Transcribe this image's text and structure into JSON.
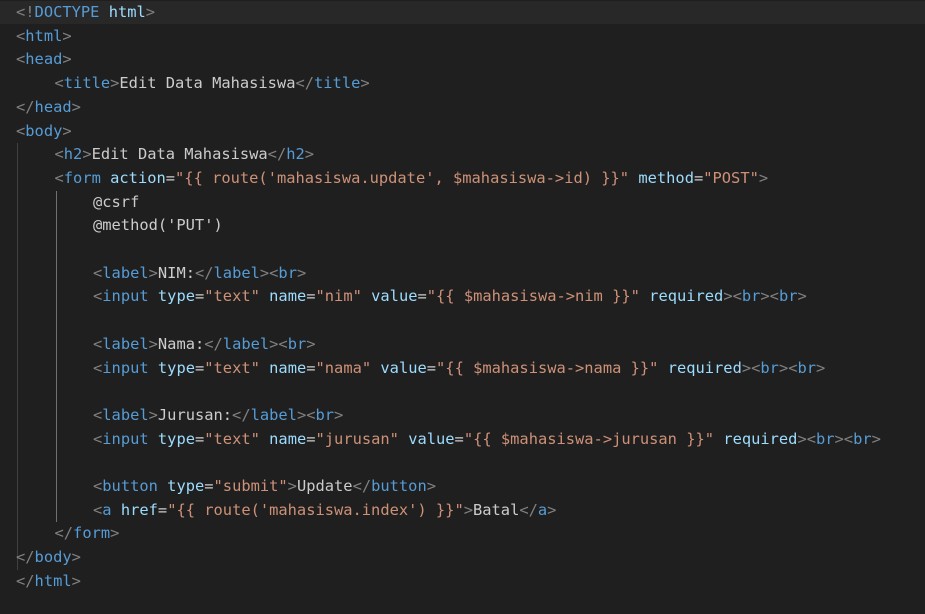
{
  "colors": {
    "background": "#1f1f1f",
    "current_line": "#282828",
    "tag": "#569cd6",
    "attribute": "#9cdcfe",
    "string": "#ce9178",
    "text": "#cccccc",
    "bracket": "#808080"
  },
  "editor": {
    "lines": [
      {
        "indent": 0,
        "tokens": [
          {
            "k": "punct",
            "t": "<!"
          },
          {
            "k": "tag",
            "t": "DOCTYPE"
          },
          {
            "k": "text",
            "t": " "
          },
          {
            "k": "attr",
            "t": "html"
          },
          {
            "k": "punct",
            "t": ">"
          }
        ]
      },
      {
        "indent": 0,
        "tokens": [
          {
            "k": "punct",
            "t": "<"
          },
          {
            "k": "tag",
            "t": "html"
          },
          {
            "k": "punct",
            "t": ">"
          }
        ]
      },
      {
        "indent": 0,
        "tokens": [
          {
            "k": "punct",
            "t": "<"
          },
          {
            "k": "tag",
            "t": "head"
          },
          {
            "k": "punct",
            "t": ">"
          }
        ]
      },
      {
        "indent": 1,
        "tokens": [
          {
            "k": "punct",
            "t": "<"
          },
          {
            "k": "tag",
            "t": "title"
          },
          {
            "k": "punct",
            "t": ">"
          },
          {
            "k": "text",
            "t": "Edit Data Mahasiswa"
          },
          {
            "k": "punct",
            "t": "</"
          },
          {
            "k": "tag",
            "t": "title"
          },
          {
            "k": "punct",
            "t": ">"
          }
        ]
      },
      {
        "indent": 0,
        "tokens": [
          {
            "k": "punct",
            "t": "</"
          },
          {
            "k": "tag",
            "t": "head"
          },
          {
            "k": "punct",
            "t": ">"
          }
        ]
      },
      {
        "indent": 0,
        "tokens": [
          {
            "k": "punct",
            "t": "<"
          },
          {
            "k": "tag",
            "t": "body"
          },
          {
            "k": "punct",
            "t": ">"
          }
        ]
      },
      {
        "indent": 1,
        "tokens": [
          {
            "k": "punct",
            "t": "<"
          },
          {
            "k": "tag",
            "t": "h2"
          },
          {
            "k": "punct",
            "t": ">"
          },
          {
            "k": "text",
            "t": "Edit Data Mahasiswa"
          },
          {
            "k": "punct",
            "t": "</"
          },
          {
            "k": "tag",
            "t": "h2"
          },
          {
            "k": "punct",
            "t": ">"
          }
        ]
      },
      {
        "indent": 1,
        "tokens": [
          {
            "k": "punct",
            "t": "<"
          },
          {
            "k": "tag",
            "t": "form"
          },
          {
            "k": "text",
            "t": " "
          },
          {
            "k": "attr",
            "t": "action"
          },
          {
            "k": "eq",
            "t": "="
          },
          {
            "k": "str",
            "t": "\"{{ route('mahasiswa.update', $mahasiswa->id) }}\""
          },
          {
            "k": "text",
            "t": " "
          },
          {
            "k": "attr",
            "t": "method"
          },
          {
            "k": "eq",
            "t": "="
          },
          {
            "k": "str",
            "t": "\"POST\""
          },
          {
            "k": "punct",
            "t": ">"
          }
        ]
      },
      {
        "indent": 2,
        "tokens": [
          {
            "k": "directive",
            "t": "@csrf"
          }
        ]
      },
      {
        "indent": 2,
        "tokens": [
          {
            "k": "directive",
            "t": "@method('PUT')"
          }
        ]
      },
      {
        "indent": 0,
        "tokens": []
      },
      {
        "indent": 2,
        "tokens": [
          {
            "k": "punct",
            "t": "<"
          },
          {
            "k": "tag",
            "t": "label"
          },
          {
            "k": "punct",
            "t": ">"
          },
          {
            "k": "text",
            "t": "NIM:"
          },
          {
            "k": "punct",
            "t": "</"
          },
          {
            "k": "tag",
            "t": "label"
          },
          {
            "k": "punct",
            "t": "><"
          },
          {
            "k": "tag",
            "t": "br"
          },
          {
            "k": "punct",
            "t": ">"
          }
        ]
      },
      {
        "indent": 2,
        "tokens": [
          {
            "k": "punct",
            "t": "<"
          },
          {
            "k": "tag",
            "t": "input"
          },
          {
            "k": "text",
            "t": " "
          },
          {
            "k": "attr",
            "t": "type"
          },
          {
            "k": "eq",
            "t": "="
          },
          {
            "k": "str",
            "t": "\"text\""
          },
          {
            "k": "text",
            "t": " "
          },
          {
            "k": "attr",
            "t": "name"
          },
          {
            "k": "eq",
            "t": "="
          },
          {
            "k": "str",
            "t": "\"nim\""
          },
          {
            "k": "text",
            "t": " "
          },
          {
            "k": "attr",
            "t": "value"
          },
          {
            "k": "eq",
            "t": "="
          },
          {
            "k": "str",
            "t": "\"{{ $mahasiswa->nim }}\""
          },
          {
            "k": "text",
            "t": " "
          },
          {
            "k": "attr",
            "t": "required"
          },
          {
            "k": "punct",
            "t": "><"
          },
          {
            "k": "tag",
            "t": "br"
          },
          {
            "k": "punct",
            "t": "><"
          },
          {
            "k": "tag",
            "t": "br"
          },
          {
            "k": "punct",
            "t": ">"
          }
        ]
      },
      {
        "indent": 0,
        "tokens": []
      },
      {
        "indent": 2,
        "tokens": [
          {
            "k": "punct",
            "t": "<"
          },
          {
            "k": "tag",
            "t": "label"
          },
          {
            "k": "punct",
            "t": ">"
          },
          {
            "k": "text",
            "t": "Nama:"
          },
          {
            "k": "punct",
            "t": "</"
          },
          {
            "k": "tag",
            "t": "label"
          },
          {
            "k": "punct",
            "t": "><"
          },
          {
            "k": "tag",
            "t": "br"
          },
          {
            "k": "punct",
            "t": ">"
          }
        ]
      },
      {
        "indent": 2,
        "tokens": [
          {
            "k": "punct",
            "t": "<"
          },
          {
            "k": "tag",
            "t": "input"
          },
          {
            "k": "text",
            "t": " "
          },
          {
            "k": "attr",
            "t": "type"
          },
          {
            "k": "eq",
            "t": "="
          },
          {
            "k": "str",
            "t": "\"text\""
          },
          {
            "k": "text",
            "t": " "
          },
          {
            "k": "attr",
            "t": "name"
          },
          {
            "k": "eq",
            "t": "="
          },
          {
            "k": "str",
            "t": "\"nama\""
          },
          {
            "k": "text",
            "t": " "
          },
          {
            "k": "attr",
            "t": "value"
          },
          {
            "k": "eq",
            "t": "="
          },
          {
            "k": "str",
            "t": "\"{{ $mahasiswa->nama }}\""
          },
          {
            "k": "text",
            "t": " "
          },
          {
            "k": "attr",
            "t": "required"
          },
          {
            "k": "punct",
            "t": "><"
          },
          {
            "k": "tag",
            "t": "br"
          },
          {
            "k": "punct",
            "t": "><"
          },
          {
            "k": "tag",
            "t": "br"
          },
          {
            "k": "punct",
            "t": ">"
          }
        ]
      },
      {
        "indent": 0,
        "tokens": []
      },
      {
        "indent": 2,
        "tokens": [
          {
            "k": "punct",
            "t": "<"
          },
          {
            "k": "tag",
            "t": "label"
          },
          {
            "k": "punct",
            "t": ">"
          },
          {
            "k": "text",
            "t": "Jurusan:"
          },
          {
            "k": "punct",
            "t": "</"
          },
          {
            "k": "tag",
            "t": "label"
          },
          {
            "k": "punct",
            "t": "><"
          },
          {
            "k": "tag",
            "t": "br"
          },
          {
            "k": "punct",
            "t": ">"
          }
        ]
      },
      {
        "indent": 2,
        "tokens": [
          {
            "k": "punct",
            "t": "<"
          },
          {
            "k": "tag",
            "t": "input"
          },
          {
            "k": "text",
            "t": " "
          },
          {
            "k": "attr",
            "t": "type"
          },
          {
            "k": "eq",
            "t": "="
          },
          {
            "k": "str",
            "t": "\"text\""
          },
          {
            "k": "text",
            "t": " "
          },
          {
            "k": "attr",
            "t": "name"
          },
          {
            "k": "eq",
            "t": "="
          },
          {
            "k": "str",
            "t": "\"jurusan\""
          },
          {
            "k": "text",
            "t": " "
          },
          {
            "k": "attr",
            "t": "value"
          },
          {
            "k": "eq",
            "t": "="
          },
          {
            "k": "str",
            "t": "\"{{ $mahasiswa->jurusan }}\""
          },
          {
            "k": "text",
            "t": " "
          },
          {
            "k": "attr",
            "t": "required"
          },
          {
            "k": "punct",
            "t": "><"
          },
          {
            "k": "tag",
            "t": "br"
          },
          {
            "k": "punct",
            "t": "><"
          },
          {
            "k": "tag",
            "t": "br"
          },
          {
            "k": "punct",
            "t": ">"
          }
        ]
      },
      {
        "indent": 0,
        "tokens": []
      },
      {
        "indent": 2,
        "tokens": [
          {
            "k": "punct",
            "t": "<"
          },
          {
            "k": "tag",
            "t": "button"
          },
          {
            "k": "text",
            "t": " "
          },
          {
            "k": "attr",
            "t": "type"
          },
          {
            "k": "eq",
            "t": "="
          },
          {
            "k": "str",
            "t": "\"submit\""
          },
          {
            "k": "punct",
            "t": ">"
          },
          {
            "k": "text",
            "t": "Update"
          },
          {
            "k": "punct",
            "t": "</"
          },
          {
            "k": "tag",
            "t": "button"
          },
          {
            "k": "punct",
            "t": ">"
          }
        ]
      },
      {
        "indent": 2,
        "tokens": [
          {
            "k": "punct",
            "t": "<"
          },
          {
            "k": "tag",
            "t": "a"
          },
          {
            "k": "text",
            "t": " "
          },
          {
            "k": "attr",
            "t": "href"
          },
          {
            "k": "eq",
            "t": "="
          },
          {
            "k": "str",
            "t": "\"{{ route('mahasiswa.index') }}\""
          },
          {
            "k": "punct",
            "t": ">"
          },
          {
            "k": "text",
            "t": "Batal"
          },
          {
            "k": "punct",
            "t": "</"
          },
          {
            "k": "tag",
            "t": "a"
          },
          {
            "k": "punct",
            "t": ">"
          }
        ]
      },
      {
        "indent": 1,
        "tokens": [
          {
            "k": "punct",
            "t": "</"
          },
          {
            "k": "tag",
            "t": "form"
          },
          {
            "k": "punct",
            "t": ">"
          }
        ]
      },
      {
        "indent": 0,
        "tokens": [
          {
            "k": "punct",
            "t": "</"
          },
          {
            "k": "tag",
            "t": "body"
          },
          {
            "k": "punct",
            "t": ">"
          }
        ]
      },
      {
        "indent": 0,
        "tokens": [
          {
            "k": "punct",
            "t": "</"
          },
          {
            "k": "tag",
            "t": "html"
          },
          {
            "k": "punct",
            "t": ">"
          }
        ]
      }
    ]
  }
}
